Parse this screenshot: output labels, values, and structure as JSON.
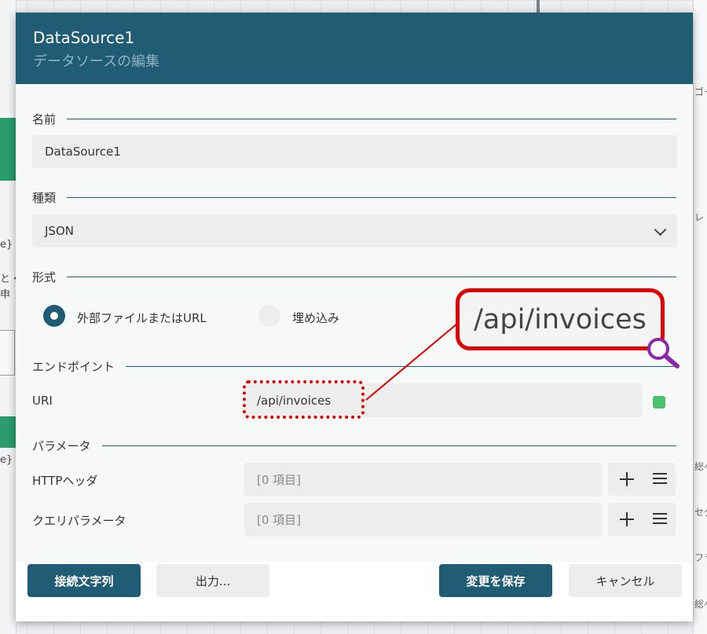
{
  "background": {
    "left_fragments": [
      "e}",
      "と・",
      "申",
      "e}"
    ],
    "right_fragments": [
      "ゴー",
      "レ",
      "総へ",
      "セグ",
      "フラ",
      "総へ"
    ]
  },
  "dialog": {
    "title": "DataSource1",
    "subtitle": "データソースの編集",
    "name": {
      "label": "名前",
      "value": "DataSource1"
    },
    "type": {
      "label": "種類",
      "value": "JSON"
    },
    "format": {
      "label": "形式",
      "options": [
        {
          "label": "外部ファイルまたはURL",
          "selected": true
        },
        {
          "label": "埋め込み",
          "selected": false
        }
      ]
    },
    "endpoint": {
      "label": "エンドポイント",
      "uri_label": "URI",
      "uri_value": "/api/invoices",
      "status_color": "#4cc26f"
    },
    "parameters": {
      "label": "パラメータ",
      "rows": [
        {
          "label": "HTTPヘッダ",
          "value": "[0 項目]"
        },
        {
          "label": "クエリパラメータ",
          "value": "[0 項目]"
        }
      ]
    },
    "footer": {
      "connection_string": "接続文字列",
      "output": "出力...",
      "save": "変更を保存",
      "cancel": "キャンセル"
    }
  },
  "callout": {
    "zoom_text": "/api/invoices",
    "color": "#e00000",
    "icon": "magnifier-icon"
  },
  "colors": {
    "header": "#215c75",
    "accent": "#215c75",
    "field_bg": "#eceeee"
  }
}
